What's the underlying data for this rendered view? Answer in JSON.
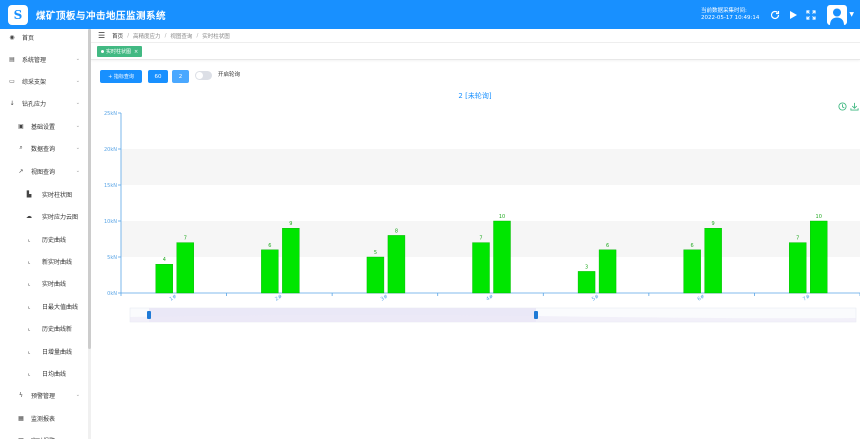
{
  "header": {
    "logo_text": "S",
    "title": "煤矿顶板与冲击地压监测系统",
    "time_label": "当前数据采集时间:",
    "time_value": "2022-05-17 10:49:14",
    "icons": [
      "refresh-icon",
      "play-icon",
      "fullscreen-icon",
      "user-avatar"
    ]
  },
  "sidebar": {
    "items": [
      {
        "label": "首页",
        "icon": "dashboard-icon",
        "chevron": false,
        "level": 0
      },
      {
        "label": "系统管理",
        "icon": "system-icon",
        "chevron": true,
        "level": 0
      },
      {
        "label": "综采支架",
        "icon": "support-icon",
        "chevron": true,
        "level": 0
      },
      {
        "label": "钻孔应力",
        "icon": "drill-icon",
        "chevron": true,
        "level": 0
      },
      {
        "label": "基础设置",
        "icon": "settings-icon",
        "chevron": true,
        "level": 1
      },
      {
        "label": "数据查询",
        "icon": "search-icon",
        "chevron": true,
        "level": 1
      },
      {
        "label": "视图查询",
        "icon": "chart-icon",
        "chevron": true,
        "level": 1
      },
      {
        "label": "实时柱状图",
        "icon": "bar-chart-icon",
        "chevron": false,
        "level": 2
      },
      {
        "label": "实时应力云图",
        "icon": "cloud-icon",
        "chevron": false,
        "level": 2
      },
      {
        "label": "历史曲线",
        "icon": "line-chart-icon",
        "chevron": false,
        "level": 2
      },
      {
        "label": "新实时曲线",
        "icon": "line-chart-icon",
        "chevron": false,
        "level": 2
      },
      {
        "label": "实时曲线",
        "icon": "line-chart-icon",
        "chevron": false,
        "level": 2
      },
      {
        "label": "日最大值曲线",
        "icon": "line-chart-icon",
        "chevron": false,
        "level": 2
      },
      {
        "label": "历史曲线新",
        "icon": "line-chart-icon",
        "chevron": false,
        "level": 2
      },
      {
        "label": "日增量曲线",
        "icon": "line-chart-icon",
        "chevron": false,
        "level": 2
      },
      {
        "label": "日均曲线",
        "icon": "line-chart-icon",
        "chevron": false,
        "level": 2
      },
      {
        "label": "预警管理",
        "icon": "warning-icon",
        "chevron": true,
        "level": 1
      },
      {
        "label": "监测报表",
        "icon": "report-icon",
        "chevron": false,
        "level": 1
      },
      {
        "label": "实时报警",
        "icon": "alarm-icon",
        "chevron": false,
        "level": 1
      }
    ]
  },
  "breadcrumb": {
    "items": [
      "首页",
      "/",
      "高精度应力",
      "/",
      "视图查询",
      "/",
      "实时柱状图"
    ]
  },
  "tags": {
    "active": "实时柱状图",
    "close": "×"
  },
  "toolbar": {
    "query_label": "+ 指标查询",
    "btn_60": "60",
    "btn_2": "2",
    "toggle_label": "开启轮询",
    "toggle_on": false
  },
  "colors": {
    "primary": "#1890ff",
    "bar": "#00e600",
    "tag": "#42b983"
  },
  "chart_data": {
    "type": "bar",
    "title": "2 [未轮询]",
    "categories": [
      "1#",
      "2#",
      "3#",
      "4#",
      "5#",
      "6#",
      "7#"
    ],
    "series": [
      {
        "values": [
          4,
          6,
          5,
          7,
          3,
          6,
          7
        ]
      },
      {
        "values": [
          7,
          9,
          8,
          10,
          6,
          9,
          10
        ]
      }
    ],
    "ylabel": "",
    "ylim": [
      0,
      25
    ],
    "yticks": [
      "0kN",
      "5kN",
      "10kN",
      "15kN",
      "20kN",
      "25kN"
    ],
    "data_labels": true,
    "grid": "banded",
    "datazoom": true,
    "toolbox": [
      "restore-icon",
      "save-image-icon"
    ]
  }
}
